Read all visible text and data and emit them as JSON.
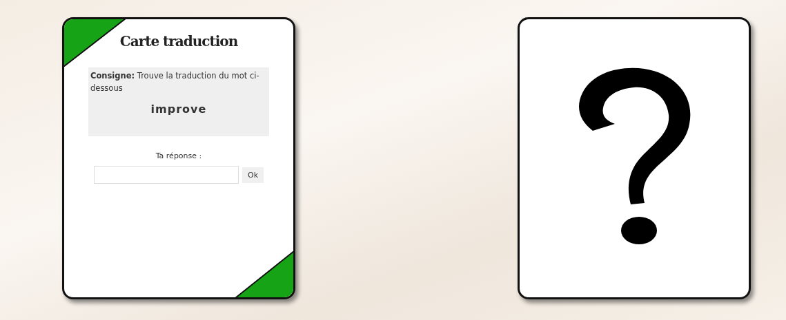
{
  "translation_card": {
    "title": "Carte traduction",
    "instruction": "**Consigne:** Trouve la traduction du mot ci-dessous",
    "word": "improve",
    "answer_label": "Ta réponse :",
    "submit_button": "Ok"
  },
  "hidden_card": {
    "kind": "question"
  }
}
